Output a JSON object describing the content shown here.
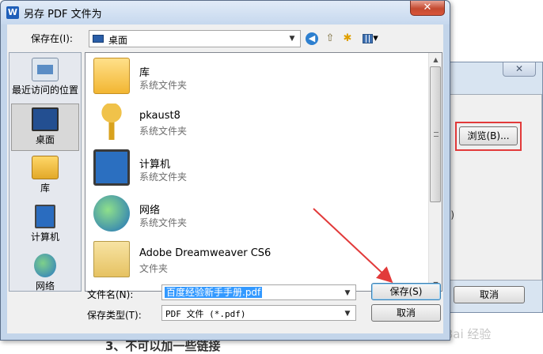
{
  "window": {
    "title": "另存 PDF 文件为",
    "app_icon": "W",
    "close_glyph": "✕"
  },
  "toolbar": {
    "save_in_label": "保存在(I):",
    "location_value": "桌面",
    "back_glyph": "◀",
    "up_glyph": "⇧",
    "newfolder_glyph": "✱",
    "views_arrow": "▾"
  },
  "places": [
    {
      "label": "最近访问的位置",
      "icon": "recent-places-icon"
    },
    {
      "label": "桌面",
      "icon": "desktop-icon"
    },
    {
      "label": "库",
      "icon": "libraries-icon"
    },
    {
      "label": "计算机",
      "icon": "computer-icon"
    },
    {
      "label": "网络",
      "icon": "network-icon"
    }
  ],
  "files": [
    {
      "name": "库",
      "type": "系统文件夹",
      "icon": "folder-icon"
    },
    {
      "name": "pkaust8",
      "type": "系统文件夹",
      "icon": "key-icon"
    },
    {
      "name": "计算机",
      "type": "系统文件夹",
      "icon": "computer-icon"
    },
    {
      "name": "网络",
      "type": "系统文件夹",
      "icon": "network-icon"
    },
    {
      "name": "Adobe Dreamweaver CS6",
      "type": "文件夹",
      "icon": "folder-icon"
    }
  ],
  "scrollbar": {
    "up": "▲",
    "down": "▼"
  },
  "form": {
    "filename_label": "文件名(N):",
    "filename_value": "百度经验新手手册.pdf",
    "filetype_label": "保存类型(T):",
    "filetype_value": "PDF 文件 (*.pdf)",
    "save_button": "保存(S)",
    "cancel_button": "取消",
    "dropdown_arrow": "▼"
  },
  "background": {
    "close_glyph": "✕",
    "browse_button": "浏览(B)...",
    "cancel_button": "取消",
    "fragment_text": "j)",
    "bottom_text": "3、不可以加一些链接",
    "watermark": "Bai 经验"
  },
  "colors": {
    "annotation_red": "#e23a3a",
    "selection_blue": "#3399ff"
  }
}
